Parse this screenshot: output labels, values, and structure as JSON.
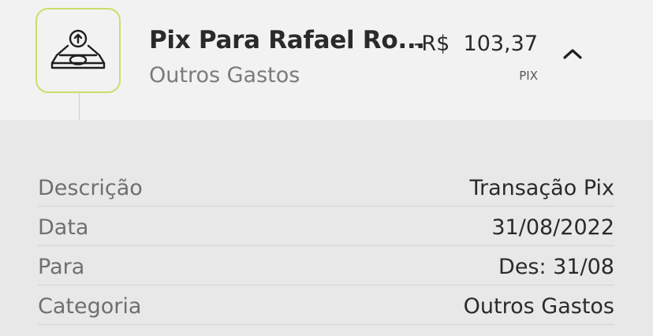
{
  "transaction": {
    "icon": "upload-tray-icon",
    "title": "Pix Para Rafael Ro...",
    "category": "Outros Gastos",
    "amount": "-R$  103,37",
    "method": "PIX",
    "expanded": true
  },
  "details": {
    "rows": [
      {
        "label": "Descrição",
        "value": "Transação Pix"
      },
      {
        "label": "Data",
        "value": "31/08/2022"
      },
      {
        "label": "Para",
        "value": "Des: 31/08"
      },
      {
        "label": "Categoria",
        "value": "Outros Gastos"
      }
    ]
  },
  "colors": {
    "accent_border": "#cfdc6a",
    "header_bg": "#f2f2f2",
    "details_bg": "#e8e8e8"
  }
}
